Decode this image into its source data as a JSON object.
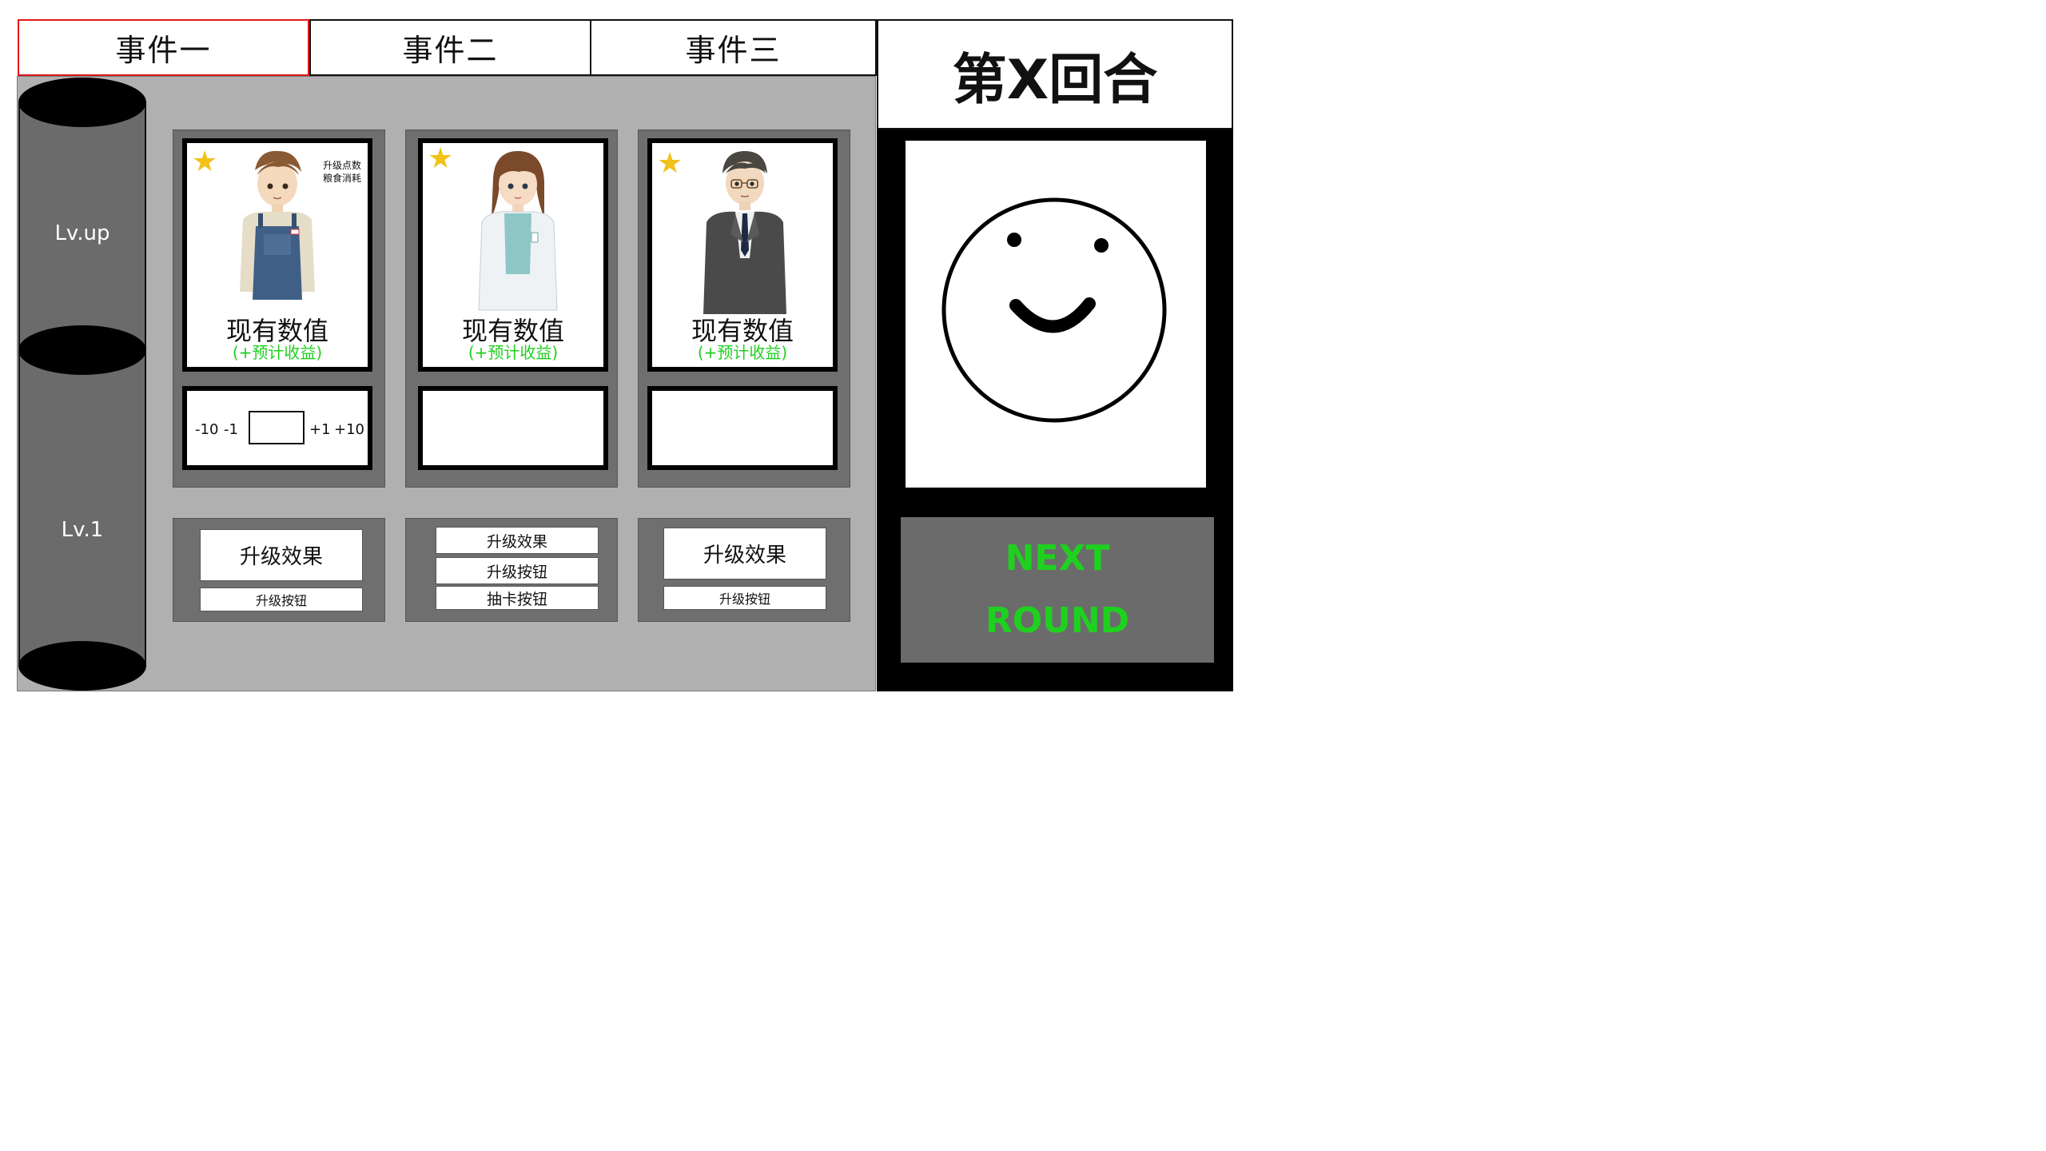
{
  "tabs": [
    "事件一",
    "事件二",
    "事件三"
  ],
  "round_label": "第X回合",
  "sidebar": {
    "top_label": "Lv.up",
    "bottom_label": "Lv.1"
  },
  "cards": [
    {
      "character": "farmer in overalls",
      "meta_line1": "升级点数",
      "meta_line2": "粮食消耗",
      "value_label": "现有数值",
      "gain_label": "(+预计收益)",
      "stepper": {
        "minus10": "-10",
        "minus1": "-1",
        "plus1": "+1",
        "plus10": "+10"
      }
    },
    {
      "character": "researcher in lab coat",
      "value_label": "现有数值",
      "gain_label": "(+预计收益)"
    },
    {
      "character": "businessman in suit",
      "value_label": "现有数值",
      "gain_label": "(+预计收益)"
    }
  ],
  "bottom_panels": [
    {
      "effect": "升级效果",
      "upgrade": "升级按钮"
    },
    {
      "effect": "升级效果",
      "upgrade": "升级按钮",
      "draw": "抽卡按钮"
    },
    {
      "effect": "升级效果",
      "upgrade": "升级按钮"
    }
  ],
  "next_round": {
    "line1": "NEXT",
    "line2": "ROUND"
  },
  "colors": {
    "active_tab_border": "#e01818",
    "gain_text": "#1fcf1f",
    "next_text": "#1fd11f",
    "star": "#f2c21b"
  }
}
